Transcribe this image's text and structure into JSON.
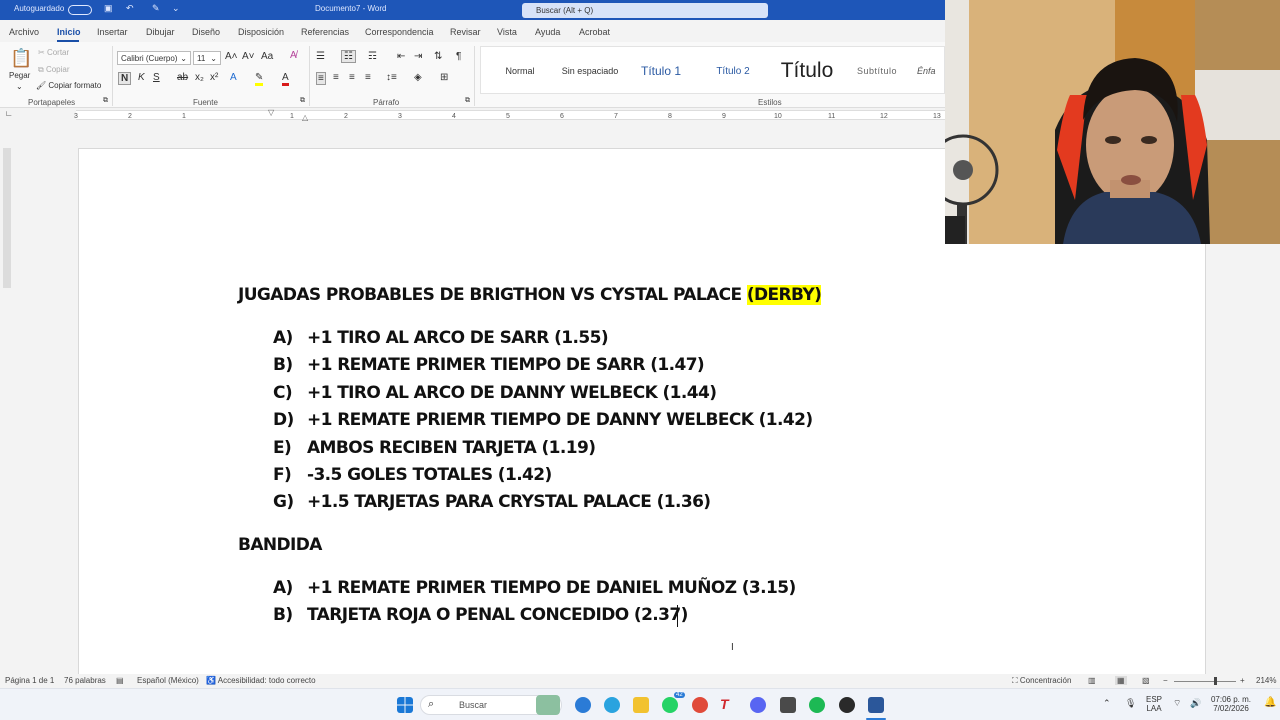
{
  "titlebar": {
    "autosave": "Autoguardado",
    "doc_title": "Documento7 - Word",
    "search_placeholder": "Buscar (Alt + Q)"
  },
  "menu": {
    "tabs": [
      "Archivo",
      "Inicio",
      "Insertar",
      "Dibujar",
      "Diseño",
      "Disposición",
      "Referencias",
      "Correspondencia",
      "Revisar",
      "Vista",
      "Ayuda",
      "Acrobat"
    ],
    "active": "Inicio"
  },
  "ribbon": {
    "clipboard": {
      "paste": "Pegar",
      "cut": "Cortar",
      "copy": "Copiar",
      "format_painter": "Copiar formato",
      "label": "Portapapeles"
    },
    "font": {
      "name": "Calibri (Cuerpo)",
      "size": "11",
      "label": "Fuente"
    },
    "paragraph": {
      "label": "Párrafo"
    },
    "styles": {
      "label": "Estilos",
      "items": [
        "Normal",
        "Sin espaciado",
        "Título 1",
        "Título 2",
        "Título",
        "Subtítulo",
        "Énfa"
      ]
    }
  },
  "ruler": {
    "numbers": [
      "3",
      "2",
      "1",
      "1",
      "2",
      "3",
      "4",
      "5",
      "6",
      "7",
      "8",
      "9",
      "10",
      "11",
      "12",
      "13"
    ]
  },
  "document": {
    "heading_main": "JUGADAS PROBABLES DE BRIGTHON VS CYSTAL PALACE ",
    "heading_tag": "(DERBY)",
    "list1": [
      {
        "marker": "A)",
        "text": "+1 TIRO AL ARCO DE SARR (1.55)"
      },
      {
        "marker": "B)",
        "text": "+1 REMATE PRIMER TIEMPO DE SARR (1.47)"
      },
      {
        "marker": "C)",
        "text": "+1 TIRO AL ARCO DE DANNY WELBECK (1.44)"
      },
      {
        "marker": "D)",
        "text": "+1 REMATE PRIEMR TIEMPO DE DANNY WELBECK (1.42)"
      },
      {
        "marker": "E)",
        "text": "AMBOS RECIBEN TARJETA (1.19)"
      },
      {
        "marker": "F)",
        "text": "-3.5 GOLES TOTALES (1.42)"
      },
      {
        "marker": "G)",
        "text": "+1.5 TARJETAS PARA CRYSTAL PALACE (1.36)"
      }
    ],
    "heading2": "BANDIDA",
    "list2": [
      {
        "marker": "A)",
        "text": "+1 REMATE PRIMER TIEMPO DE DANIEL MUÑOZ (3.15)"
      },
      {
        "marker": "B)",
        "text": "TARJETA ROJA O PENAL CONCEDIDO (2.37)"
      }
    ]
  },
  "status": {
    "page": "Página 1 de 1",
    "words": "76 palabras",
    "language": "Español (México)",
    "accessibility": "Accesibilidad: todo correcto",
    "focus": "Concentración",
    "zoom": "214%"
  },
  "taskbar": {
    "search": "Buscar",
    "whatsapp_badge": "42",
    "lang_top": "ESP",
    "lang_bottom": "LAA",
    "time": "07:06 p. m.",
    "date": "7/02/2026"
  }
}
